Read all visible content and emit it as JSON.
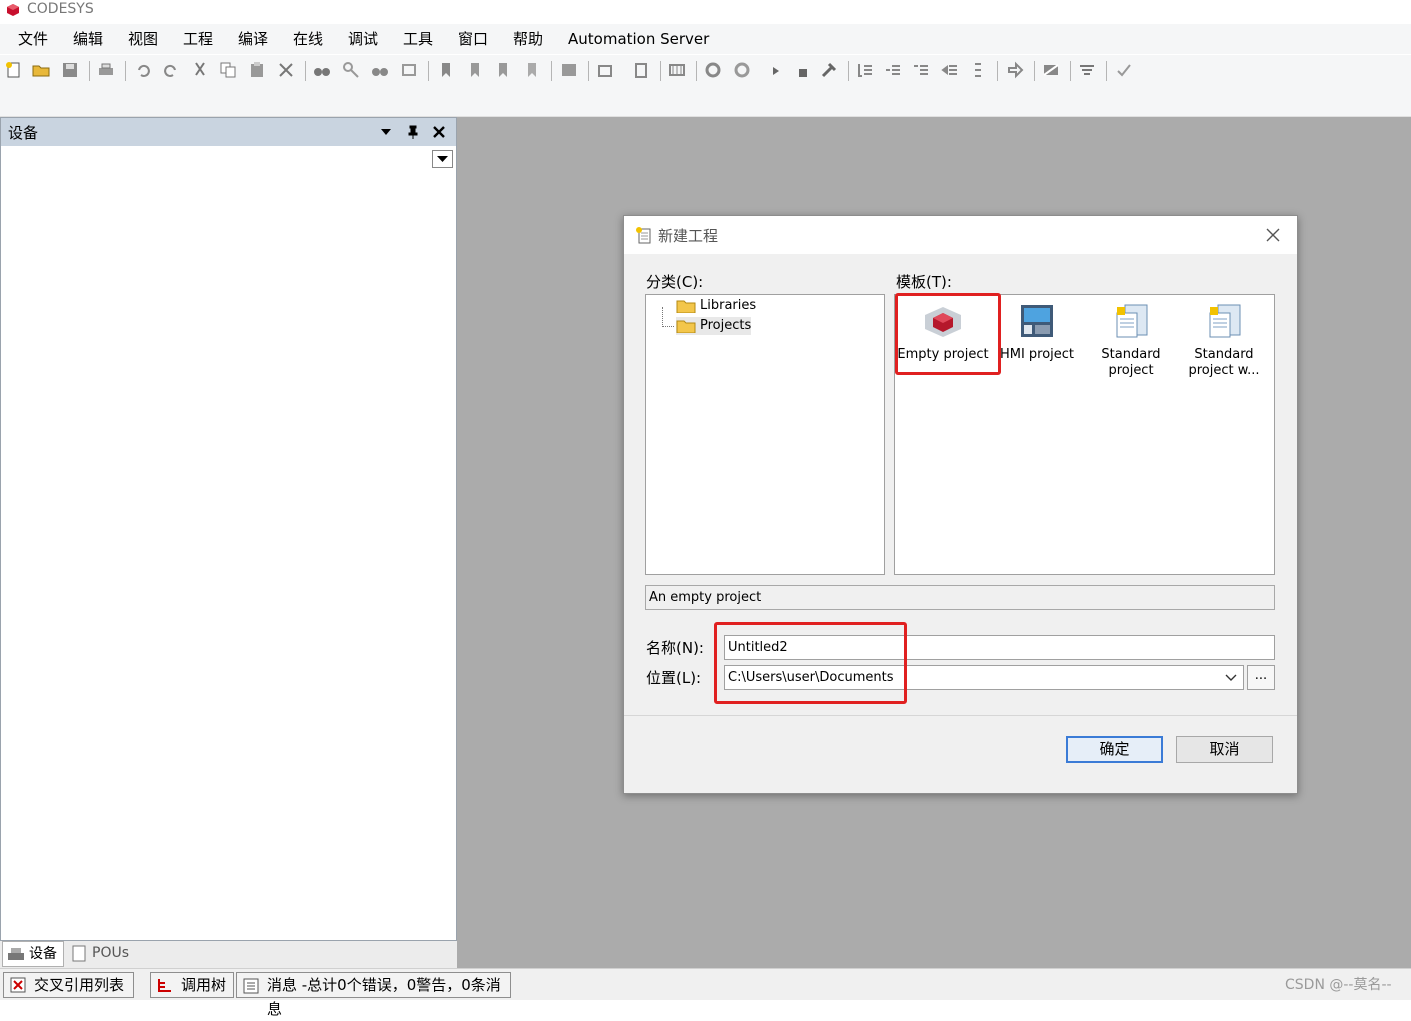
{
  "app": {
    "title": "CODESYS"
  },
  "menu": [
    "文件",
    "编辑",
    "视图",
    "工程",
    "编译",
    "在线",
    "调试",
    "工具",
    "窗口",
    "帮助",
    "Automation Server"
  ],
  "panel": {
    "title": "设备"
  },
  "bottom_tabs": {
    "devices": "设备",
    "pous": "POUs"
  },
  "statusbar": {
    "cross_ref": "交叉引用列表",
    "call_tree": "调用树",
    "messages": "消息 -总计0个错误，0警告，0条消息"
  },
  "watermark": "CSDN @--莫名--",
  "dialog": {
    "title": "新建工程",
    "category_label": "分类(C):",
    "template_label": "模板(T):",
    "categories": [
      "Libraries",
      "Projects"
    ],
    "templates": [
      {
        "name": "Empty project",
        "icon": "empty-project-icon"
      },
      {
        "name": "HMI project",
        "icon": "hmi-project-icon"
      },
      {
        "name": "Standard project",
        "icon": "standard-project-icon"
      },
      {
        "name": "Standard project w...",
        "icon": "standard-project-wizard-icon"
      }
    ],
    "selected_template": "Empty project",
    "description": "An empty project",
    "name_label": "名称(N):",
    "name_value": "Untitled2",
    "location_label": "位置(L):",
    "location_value": "C:\\Users\\user\\Documents",
    "browse_label": "...",
    "ok_label": "确定",
    "cancel_label": "取消"
  },
  "colors": {
    "highlight": "#e02020",
    "workspace": "#ababab",
    "panel_header": "#c9d4e0",
    "ok_border": "#3b7bd6"
  }
}
